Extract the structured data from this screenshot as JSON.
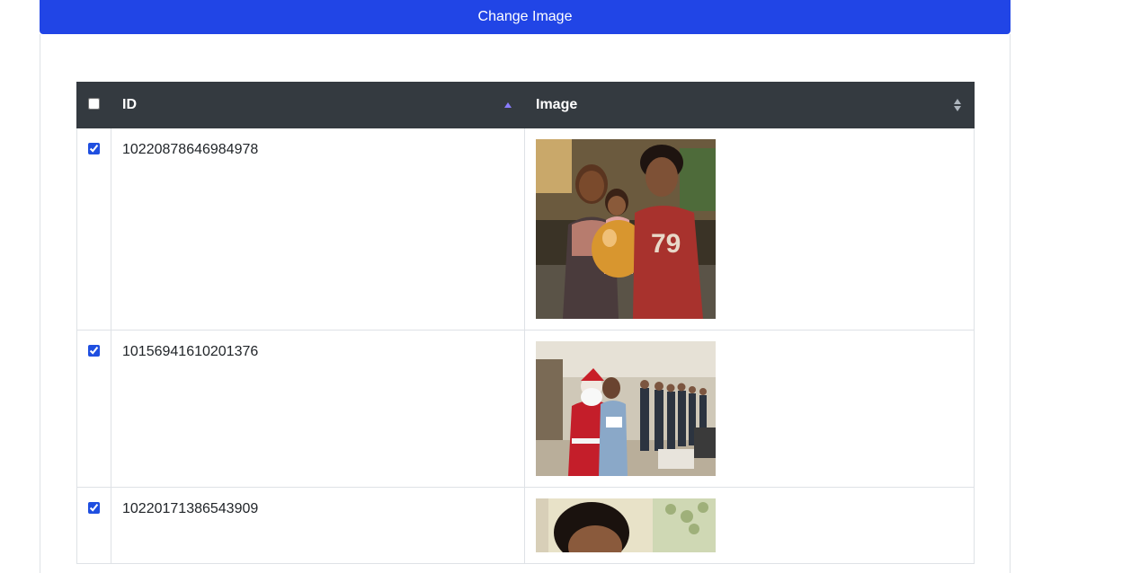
{
  "toolbar": {
    "change_image_label": "Change Image"
  },
  "table": {
    "columns": [
      {
        "label": "",
        "type": "select-all-checkbox",
        "checked": false
      },
      {
        "label": "ID",
        "sort": "ascending"
      },
      {
        "label": "Image",
        "sort": "none"
      }
    ],
    "rows": [
      {
        "checked": true,
        "id": "10220878646984978",
        "image": "family-photo-with-balloon"
      },
      {
        "checked": true,
        "id": "10156941610201376",
        "image": "office-santa-photo"
      },
      {
        "checked": true,
        "id": "10220171386543909",
        "image": "portrait-photo"
      }
    ]
  },
  "colors": {
    "primary_button": "#2145e6",
    "table_header": "#343a40",
    "sort_active": "#8a7cff",
    "checkbox": "#1f4fe0"
  }
}
